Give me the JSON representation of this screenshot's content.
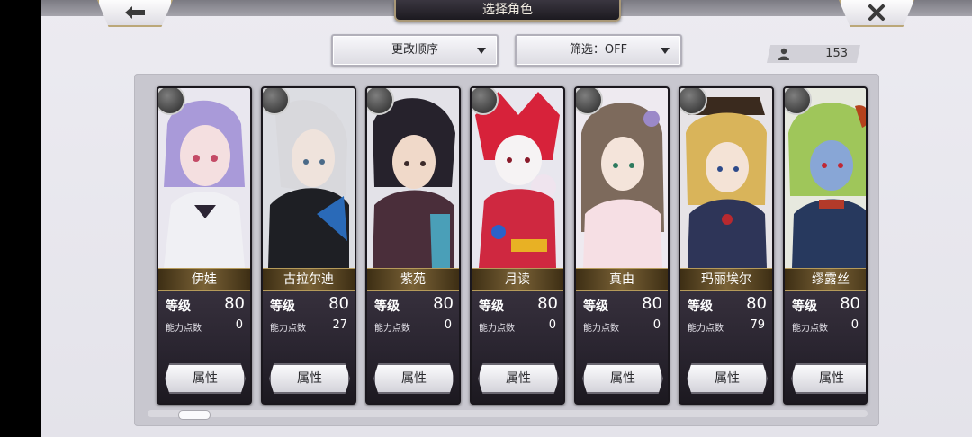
{
  "header": {
    "title": "选择角色",
    "back_icon": "arrow-left",
    "close_icon": "x-close"
  },
  "toolbar": {
    "order_label": "更改顺序",
    "filter_label": "筛选：OFF",
    "count": "153",
    "count_icon": "person-icon"
  },
  "labels": {
    "level": "等级",
    "points": "能力点数",
    "attr_button": "属性"
  },
  "characters": [
    {
      "name": "伊娃",
      "level": "80",
      "points": "0"
    },
    {
      "name": "古拉尔迪",
      "level": "80",
      "points": "27"
    },
    {
      "name": "紫苑",
      "level": "80",
      "points": "0"
    },
    {
      "name": "月读",
      "level": "80",
      "points": "0"
    },
    {
      "name": "真由",
      "level": "80",
      "points": "0"
    },
    {
      "name": "玛丽埃尔",
      "level": "80",
      "points": "79"
    },
    {
      "name": "缪露丝",
      "level": "80",
      "points": "0"
    }
  ],
  "colors": {
    "accent_gold": "#b59a5a",
    "card_dark": "#1d1a22"
  }
}
